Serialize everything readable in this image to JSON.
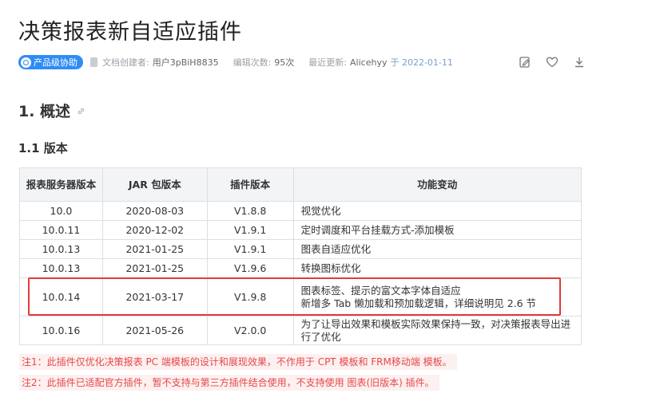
{
  "title": "决策报表新自适应插件",
  "meta": {
    "badge": "产品级协助",
    "creator_label": "文档创建者:",
    "creator": "用户3pBiH8835",
    "edits_label": "编辑次数:",
    "edits": "95次",
    "updated_label": "最近更新:",
    "updated_by": "Alicehyy",
    "updated_on": "于 2022-01-11"
  },
  "section1": "1. 概述",
  "section1_1": "1.1 版本",
  "table": {
    "headers": [
      "报表服务器版本",
      "JAR 包版本",
      "插件版本",
      "功能变动"
    ],
    "rows": [
      {
        "server": "10.0",
        "jar": "2020-08-03",
        "plugin": "V1.8.8",
        "change": [
          "视觉优化"
        ]
      },
      {
        "server": "10.0.11",
        "jar": "2020-12-02",
        "plugin": "V1.9.1",
        "change": [
          "定时调度和平台挂载方式-添加模板"
        ]
      },
      {
        "server": "10.0.13",
        "jar": "2021-01-25",
        "plugin": "V1.9.1",
        "change": [
          "图表自适应优化"
        ]
      },
      {
        "server": "10.0.13",
        "jar": "2021-01-25",
        "plugin": "V1.9.6",
        "change": [
          "转换图标优化"
        ]
      },
      {
        "server": "10.0.14",
        "jar": "2021-03-17",
        "plugin": "V1.9.8",
        "change": [
          "图表标签、提示的富文本字体自适应",
          "新增多 Tab 懒加载和预加载逻辑，详细说明见 2.6 节"
        ]
      },
      {
        "server": "10.0.16",
        "jar": "2021-05-26",
        "plugin": "V2.0.0",
        "change": [
          "为了让导出效果和模板实际效果保持一致，对决策报表导出进",
          "行了优化"
        ]
      }
    ]
  },
  "notes": [
    "注1：此插件仅优化决策报表 PC 端模板的设计和展现效果，不作用于 CPT 模板和 FRM移动端 模板。",
    "注2：此插件已适配官方插件，暂不支持与第三方插件结合使用，不支持使用 图表(旧版本) 插件。"
  ],
  "colors": {
    "accent": "#2f8cf5",
    "highlight": "#e23b3b",
    "note_text": "#e54848",
    "note_bg": "#fdf0f0"
  },
  "icons": [
    "contributor-icon",
    "doc-icon",
    "edit-icon",
    "heart-icon",
    "download-icon",
    "link-icon"
  ]
}
